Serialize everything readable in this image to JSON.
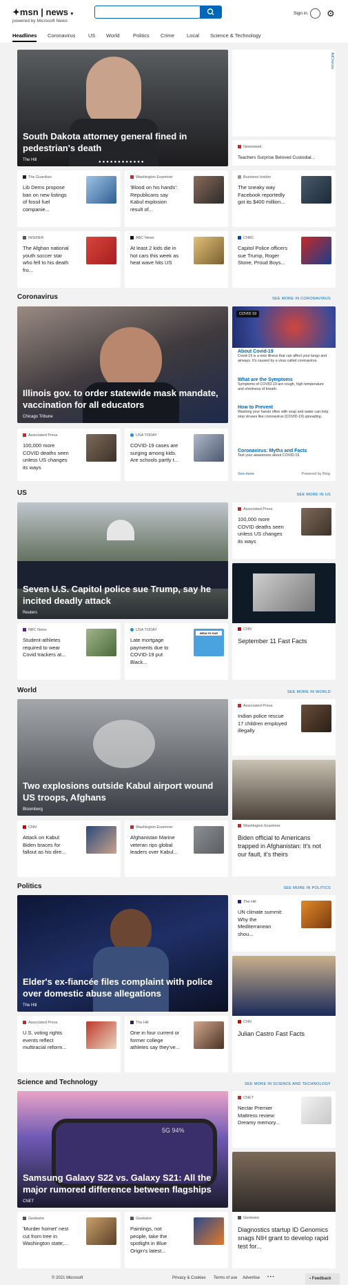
{
  "header": {
    "logo": "msn",
    "brand": "news",
    "tagline": "powered by Microsoft News",
    "signin_label": "Sign in"
  },
  "nav": [
    "Headlines",
    "Coronavirus",
    "US",
    "World",
    "Politics",
    "Crime",
    "Local",
    "Science & Technology"
  ],
  "top": {
    "hero_title": "South Dakota attorney general fined in pedestrian's death",
    "hero_source": "The Hill",
    "ad_label": "AdChoices",
    "side_source": "Newsweek",
    "side_title": "Teachers Surprise Beloved Custodial...",
    "cards": [
      {
        "source": "The Guardian",
        "title": "Lib Dems propose ban on new listings of fossil fuel companie..."
      },
      {
        "source": "Washington Examiner",
        "title": "'Blood on his hands': Republicans say Kabul explosion result of..."
      },
      {
        "source": "Business Insider",
        "title": "The sneaky way Facebook reportedly got its $400 million..."
      },
      {
        "source": "INSIDER",
        "title": "The Afghan national youth soccer star who fell to his death fro..."
      },
      {
        "source": "ABC News",
        "title": "At least 2 kids die in hot cars this week as heat wave hits US"
      },
      {
        "source": "CNBC",
        "title": "Capitol Police officers sue Trump, Roger Stone, Proud Boys..."
      }
    ]
  },
  "coronavirus": {
    "title": "Coronavirus",
    "see_more": "SEE MORE IN CORONAVIRUS",
    "hero_title": "Illinois gov. to order statewide mask mandate, vaccination for all educators",
    "hero_source": "Chicago Tribune",
    "badge": "COVID 19",
    "items": [
      {
        "h": "About Covid-19",
        "t": "Covid-19 is a new illness that can affect your lungs and airways. It's caused by a virus called coronavirus."
      },
      {
        "h": "What are the Symptoms",
        "t": "Symptoms of COVID-19 are cough, high temperature and shortness of breath."
      },
      {
        "h": "How to Prevent",
        "t": "Washing your hands often with soap and water can help stop viruses like coronavirus (COVID-19) spreading."
      },
      {
        "h": "Coronavirus: Myths and Facts",
        "t": "Test your awareness about COVID-19."
      }
    ],
    "see_more_small": "See more",
    "powered": "Powered by Bing",
    "cards": [
      {
        "source": "Associated Press",
        "title": "100,000 more COVID deaths seen unless US changes its ways"
      },
      {
        "source": "USA TODAY",
        "title": "COVID-19 cases are surging among kids. Are schools partly t..."
      }
    ]
  },
  "us": {
    "title": "US",
    "see_more": "SEE MORE IN US",
    "hero_title": "Seven U.S. Capitol police sue Trump, say he incited deadly attack",
    "hero_source": "Reuters",
    "side_source": "Associated Press",
    "side_title": "100,000 more COVID deaths seen unless US changes its ways",
    "fast_source": "CNN",
    "fast_title": "September 11 Fast Facts",
    "cards": [
      {
        "source": "NBC News",
        "title": "Student-athletes required to wear Covid trackers at..."
      },
      {
        "source": "USA TODAY",
        "title": "Late mortgage payments due to COVID-19 put Black..."
      }
    ],
    "wealth_gap": "WEALTH GAP"
  },
  "world": {
    "title": "World",
    "see_more": "SEE MORE IN WORLD",
    "hero_title": "Two explosions outside Kabul airport wound US troops, Afghans",
    "hero_source": "Bloomberg",
    "side_source": "Associated Press",
    "side_title": "Indian police rescue 17 children employed illegally",
    "big_source": "Washington Examiner",
    "big_title": "Biden official to Americans trapped in Afghanistan: It's not our fault, it's theirs",
    "cards": [
      {
        "source": "CNN",
        "title": "Attack on Kabul: Biden braces for fallout as his dire..."
      },
      {
        "source": "Washington Examiner",
        "title": "Afghanistan Marine veteran rips global leaders over Kabul..."
      }
    ]
  },
  "politics": {
    "title": "Politics",
    "see_more": "SEE MORE IN POLITICS",
    "hero_title": "Elder's ex-fiancée files complaint with police over domestic abuse allegations",
    "hero_source": "The Hill",
    "side_source": "The Hill",
    "side_title": "UN climate summit: Why the Mediterranean shou...",
    "big_source": "CNN",
    "big_title": "Julian Castro Fast Facts",
    "cards": [
      {
        "source": "Associated Press",
        "title": "U.S. voting rights events reflect multiracial reform..."
      },
      {
        "source": "The Hill",
        "title": "One in four current or former college athletes say they've..."
      }
    ]
  },
  "science": {
    "title": "Science and Technology",
    "see_more": "SEE MORE IN SCIENCE AND TECHNOLOGY",
    "hero_title": "Samsung Galaxy S22 vs. Galaxy S21: All the major rumored difference between flagships",
    "hero_source": "CNET",
    "phone_status": "5G  94%",
    "side_source": "CNET",
    "side_title": "Nectar Premier Mattress review: Dreamy memory...",
    "big_source": "Geekwire",
    "big_title": "Diagnostics startup ID Genomics snags NIH grant to develop rapid test for...",
    "cards": [
      {
        "source": "Geekwire",
        "title": "'Murder hornet' nest cut from tree in Washington state;..."
      },
      {
        "source": "Geekwire",
        "title": "Paintings, not people, take the spotlight in Blue Origin's latest..."
      }
    ]
  },
  "footer": {
    "copyright": "© 2021 Microsoft",
    "links": [
      "Privacy & Cookies",
      "Terms of use",
      "Advertise"
    ],
    "more": "• • •",
    "feedback": "Feedback"
  },
  "colors": {
    "accent": "#0067b8"
  }
}
